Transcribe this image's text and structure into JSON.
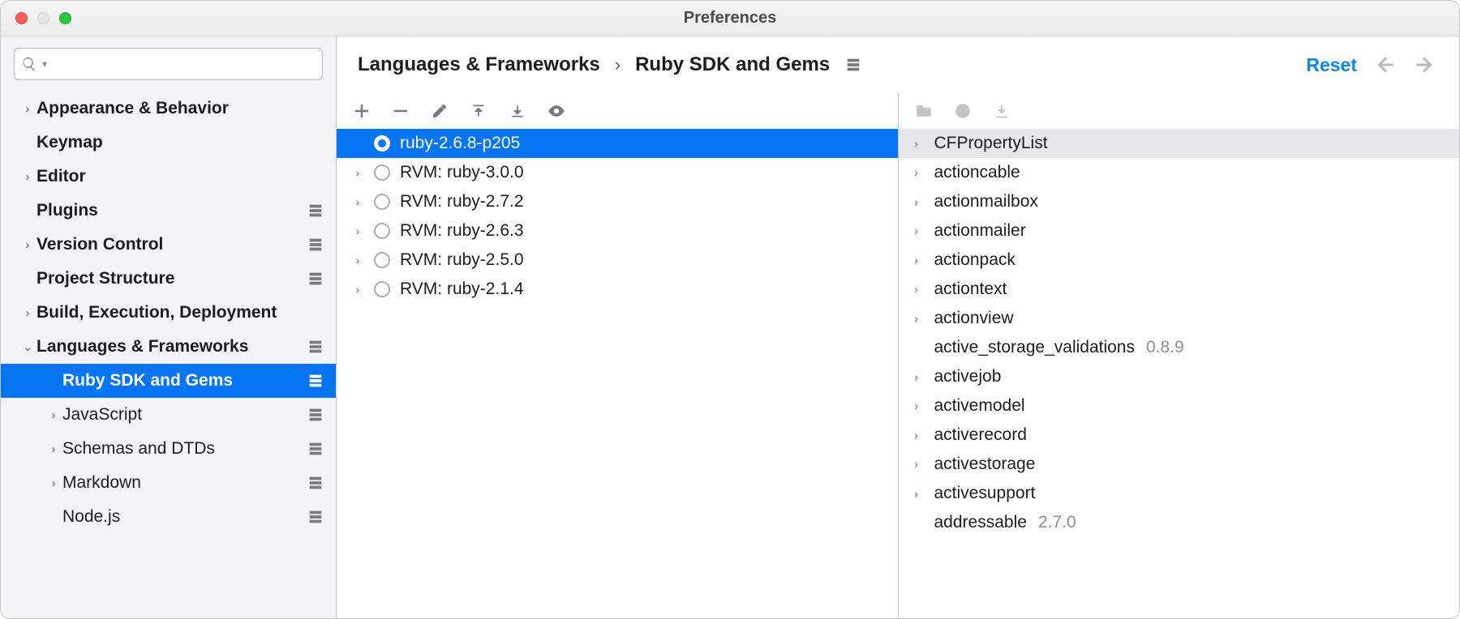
{
  "window_title": "Preferences",
  "search": {
    "placeholder": ""
  },
  "sidebar": [
    {
      "label": "Appearance & Behavior",
      "bold": true,
      "arrow": "right",
      "proj": false,
      "depth": 0,
      "selected": false
    },
    {
      "label": "Keymap",
      "bold": true,
      "arrow": "",
      "proj": false,
      "depth": 0,
      "selected": false
    },
    {
      "label": "Editor",
      "bold": true,
      "arrow": "right",
      "proj": false,
      "depth": 0,
      "selected": false
    },
    {
      "label": "Plugins",
      "bold": true,
      "arrow": "",
      "proj": true,
      "depth": 0,
      "selected": false
    },
    {
      "label": "Version Control",
      "bold": true,
      "arrow": "right",
      "proj": true,
      "depth": 0,
      "selected": false
    },
    {
      "label": "Project Structure",
      "bold": true,
      "arrow": "",
      "proj": true,
      "depth": 0,
      "selected": false
    },
    {
      "label": "Build, Execution, Deployment",
      "bold": true,
      "arrow": "right",
      "proj": false,
      "depth": 0,
      "selected": false
    },
    {
      "label": "Languages & Frameworks",
      "bold": true,
      "arrow": "down",
      "proj": true,
      "depth": 0,
      "selected": false
    },
    {
      "label": "Ruby SDK and Gems",
      "bold": true,
      "arrow": "",
      "proj": true,
      "depth": 1,
      "selected": true
    },
    {
      "label": "JavaScript",
      "bold": false,
      "arrow": "right",
      "proj": true,
      "depth": 1,
      "selected": false
    },
    {
      "label": "Schemas and DTDs",
      "bold": false,
      "arrow": "right",
      "proj": true,
      "depth": 1,
      "selected": false
    },
    {
      "label": "Markdown",
      "bold": false,
      "arrow": "right",
      "proj": true,
      "depth": 1,
      "selected": false
    },
    {
      "label": "Node.js",
      "bold": false,
      "arrow": "",
      "proj": true,
      "depth": 1,
      "selected": false
    }
  ],
  "breadcrumbs": {
    "root": "Languages & Frameworks",
    "leaf": "Ruby SDK and Gems"
  },
  "actions": {
    "reset": "Reset"
  },
  "sdks": [
    {
      "label": "ruby-2.6.8-p205",
      "selected": true,
      "hasArrow": false
    },
    {
      "label": "RVM: ruby-3.0.0",
      "selected": false,
      "hasArrow": true
    },
    {
      "label": "RVM: ruby-2.7.2",
      "selected": false,
      "hasArrow": true
    },
    {
      "label": "RVM: ruby-2.6.3",
      "selected": false,
      "hasArrow": true
    },
    {
      "label": "RVM: ruby-2.5.0",
      "selected": false,
      "hasArrow": true
    },
    {
      "label": "RVM: ruby-2.1.4",
      "selected": false,
      "hasArrow": true
    }
  ],
  "gems": [
    {
      "name": "CFPropertyList",
      "version": "",
      "arrow": true,
      "highlight": true
    },
    {
      "name": "actioncable",
      "version": "",
      "arrow": true,
      "highlight": false
    },
    {
      "name": "actionmailbox",
      "version": "",
      "arrow": true,
      "highlight": false
    },
    {
      "name": "actionmailer",
      "version": "",
      "arrow": true,
      "highlight": false
    },
    {
      "name": "actionpack",
      "version": "",
      "arrow": true,
      "highlight": false
    },
    {
      "name": "actiontext",
      "version": "",
      "arrow": true,
      "highlight": false
    },
    {
      "name": "actionview",
      "version": "",
      "arrow": true,
      "highlight": false
    },
    {
      "name": "active_storage_validations",
      "version": "0.8.9",
      "arrow": false,
      "highlight": false
    },
    {
      "name": "activejob",
      "version": "",
      "arrow": true,
      "highlight": false
    },
    {
      "name": "activemodel",
      "version": "",
      "arrow": true,
      "highlight": false
    },
    {
      "name": "activerecord",
      "version": "",
      "arrow": true,
      "highlight": false
    },
    {
      "name": "activestorage",
      "version": "",
      "arrow": true,
      "highlight": false
    },
    {
      "name": "activesupport",
      "version": "",
      "arrow": true,
      "highlight": false
    },
    {
      "name": "addressable",
      "version": "2.7.0",
      "arrow": false,
      "highlight": false
    }
  ]
}
